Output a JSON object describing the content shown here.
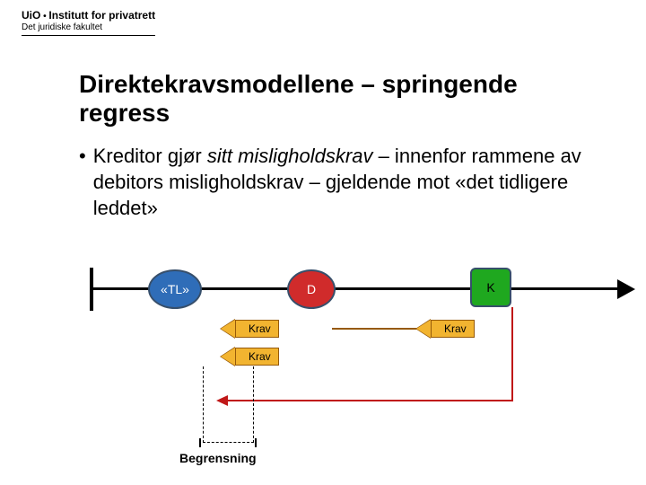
{
  "header": {
    "uio": "UiO",
    "institute": "Institutt for privatrett",
    "faculty": "Det juridiske fakultet"
  },
  "title": "Direktekravsmodellene – springende regress",
  "bullet": {
    "lead": "Kreditor gjør ",
    "italic": "sitt misligholdskrav",
    "rest": " – innenfor rammene av debitors misligholdskrav – gjeldende mot «det tidligere leddet»"
  },
  "diagram": {
    "nodes": {
      "tl": "«TL»",
      "d": "D",
      "k": "K"
    },
    "krav_label": "Krav",
    "begrensning": "Begrensning"
  }
}
